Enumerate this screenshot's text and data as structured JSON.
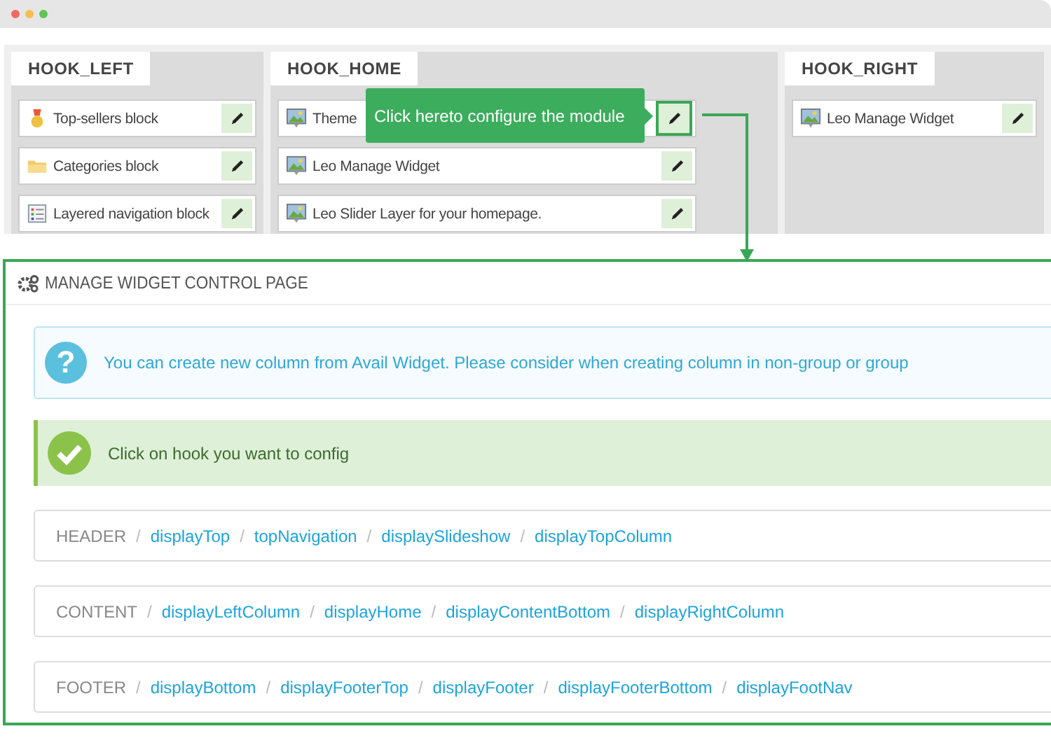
{
  "hooks": [
    {
      "name": "HOOK_LEFT",
      "modules": [
        {
          "label": "Top-sellers block",
          "kind": "medal",
          "highlighted": false
        },
        {
          "label": "Categories block",
          "kind": "folder",
          "highlighted": false
        },
        {
          "label": "Layered navigation block",
          "kind": "list",
          "highlighted": false
        }
      ]
    },
    {
      "name": "HOOK_HOME",
      "modules": [
        {
          "label": "Theme",
          "kind": "widget",
          "highlighted": true
        },
        {
          "label": "Leo Manage Widget",
          "kind": "widget",
          "highlighted": false
        },
        {
          "label": "Leo Slider Layer for your homepage.",
          "kind": "widget",
          "highlighted": false
        }
      ]
    },
    {
      "name": "HOOK_RIGHT",
      "modules": [
        {
          "label": "Leo Manage Widget",
          "kind": "widget",
          "highlighted": false
        }
      ]
    }
  ],
  "tooltip": {
    "text": "Click hereto configure the module"
  },
  "panel": {
    "title": "MANAGE WIDGET CONTROL PAGE",
    "info": {
      "icon_text": "?",
      "text": "You can create new column from Avail Widget. Please consider when creating column in non-group or group"
    },
    "success": {
      "text": "Click on hook you want to config"
    },
    "positions": [
      {
        "section": "HEADER",
        "separator": "/",
        "hooks": [
          "displayTop",
          "topNavigation",
          "displaySlideshow",
          "displayTopColumn"
        ]
      },
      {
        "section": "CONTENT",
        "separator": "/",
        "hooks": [
          "displayLeftColumn",
          "displayHome",
          "displayContentBottom",
          "displayRightColumn"
        ]
      },
      {
        "section": "FOOTER",
        "separator": "/",
        "hooks": [
          "displayBottom",
          "displayFooterTop",
          "displayFooter",
          "displayFooterBottom",
          "displayFootNav"
        ]
      }
    ]
  }
}
